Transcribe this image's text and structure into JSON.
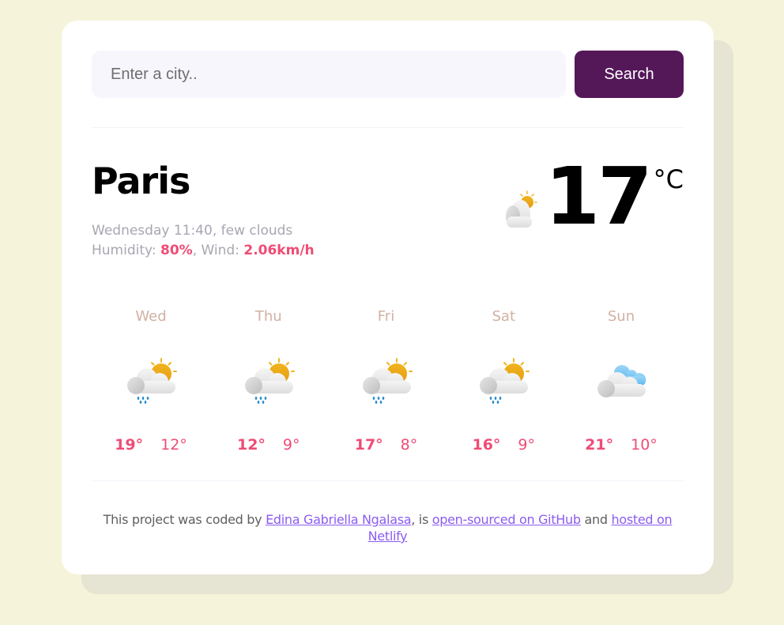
{
  "search": {
    "placeholder": "Enter a city..",
    "value": "",
    "button_label": "Search"
  },
  "current": {
    "city": "Paris",
    "datetime_description": "Wednesday 11:40, few clouds",
    "humidity_label": "Humidity: ",
    "humidity_value": "80%",
    "wind_label": ", Wind: ",
    "wind_value": "2.06km/h",
    "temperature": "17",
    "unit": "°C",
    "icon": "few-clouds-icon"
  },
  "forecast": [
    {
      "day": "Wed",
      "icon": "rain-sun-icon",
      "max": "19°",
      "min": "12°"
    },
    {
      "day": "Thu",
      "icon": "rain-sun-icon",
      "max": "12°",
      "min": "9°"
    },
    {
      "day": "Fri",
      "icon": "rain-sun-icon",
      "max": "17°",
      "min": "8°"
    },
    {
      "day": "Sat",
      "icon": "rain-sun-icon",
      "max": "16°",
      "min": "9°"
    },
    {
      "day": "Sun",
      "icon": "broken-clouds-icon",
      "max": "21°",
      "min": "10°"
    }
  ],
  "footer": {
    "text_1": "This project was coded by ",
    "author_link": "Edina Gabriella Ngalasa",
    "text_2": ", is ",
    "github_link": "open-sourced on GitHub",
    "text_3": " and ",
    "netlify_link": "hosted on Netlify"
  },
  "colors": {
    "background": "#f5f3d9",
    "accent": "#541859",
    "highlight": "#ef4c75",
    "link": "#8b5cf0"
  }
}
